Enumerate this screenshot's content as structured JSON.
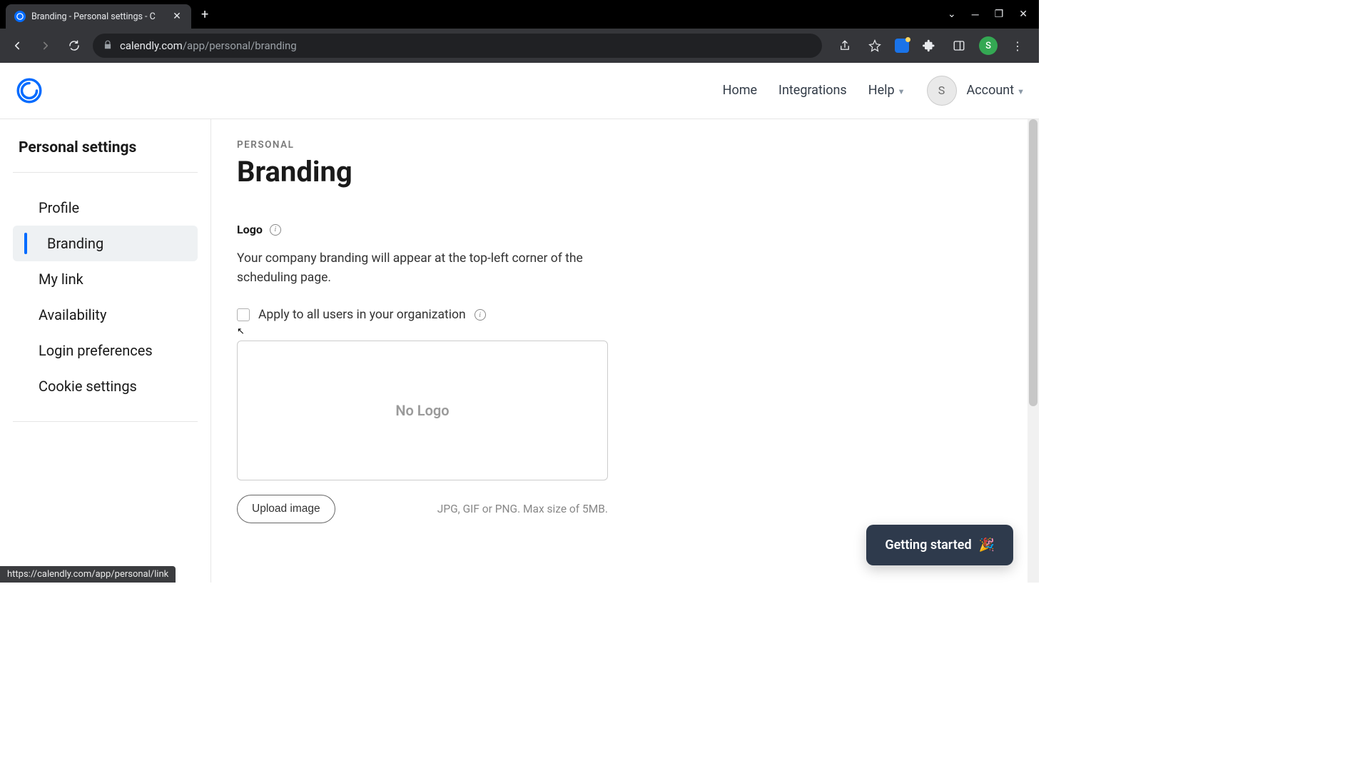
{
  "browser": {
    "tab_title": "Branding - Personal settings - C",
    "url_domain": "calendly.com",
    "url_path": "/app/personal/branding",
    "profile_initial": "S"
  },
  "header": {
    "nav": {
      "home": "Home",
      "integrations": "Integrations",
      "help": "Help",
      "account": "Account"
    },
    "user_initial": "S"
  },
  "sidebar": {
    "title": "Personal settings",
    "items": [
      "Profile",
      "Branding",
      "My link",
      "Availability",
      "Login preferences",
      "Cookie settings"
    ],
    "active_index": 1
  },
  "main": {
    "breadcrumb": "PERSONAL",
    "title": "Branding",
    "logo_section": {
      "label": "Logo",
      "description": "Your company branding will appear at the top-left corner of the scheduling page.",
      "checkbox_label": "Apply to all users in your organization",
      "placeholder": "No Logo",
      "upload_button": "Upload image",
      "upload_hint": "JPG, GIF or PNG. Max size of 5MB."
    }
  },
  "getting_started": {
    "label": "Getting started",
    "emoji": "🎉"
  },
  "status_url": "https://calendly.com/app/personal/link"
}
